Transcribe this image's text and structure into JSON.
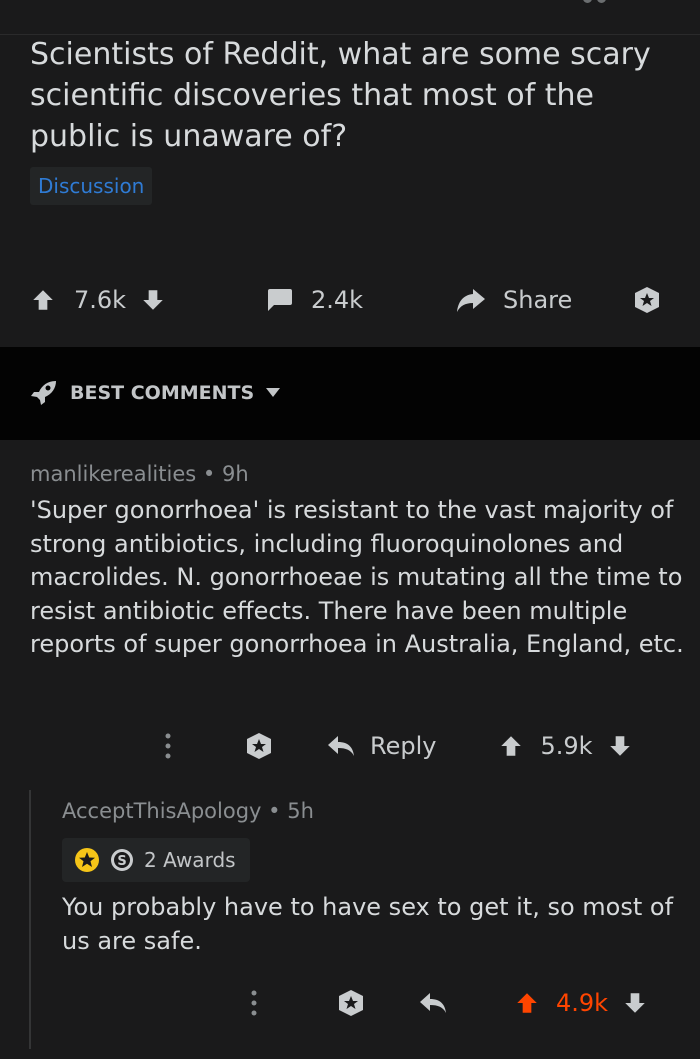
{
  "post": {
    "title": "Scientists of Reddit, what are some scary scientific discoveries that most of the public is unaware of?",
    "flair": "Discussion",
    "votes": "7.6k",
    "comments_count": "2.4k",
    "share_label": "Share",
    "icons": [
      "upvote-icon",
      "downvote-icon",
      "comment-icon",
      "share-icon",
      "award-icon"
    ]
  },
  "sort": {
    "label": "BEST COMMENTS",
    "icons": [
      "rocket-icon",
      "chevron-down-icon"
    ]
  },
  "comments": [
    {
      "author": "manlikerealities",
      "age": "9h",
      "body": "'Super gonorrhoea' is resistant to the vast majority of strong antibiotics, including fluoroquinolones and macrolides. N. gonorrhoeae is mutating all the time to resist antibiotic effects. There have been multiple reports of super gonorrhoea in Australia, England, etc.",
      "reply_label": "Reply",
      "votes": "5.9k"
    },
    {
      "author": "AcceptThisApology",
      "age": "5h",
      "awards_label": "2 Awards",
      "body": "You probably have to have sex to get it, so most of us are safe.",
      "votes": "4.9k",
      "vote_color": "#ff4500"
    }
  ],
  "colors": {
    "background": "#1a1a1b",
    "section": "#030303",
    "flair_text": "#2f7bd4",
    "upvoted": "#ff4500"
  }
}
